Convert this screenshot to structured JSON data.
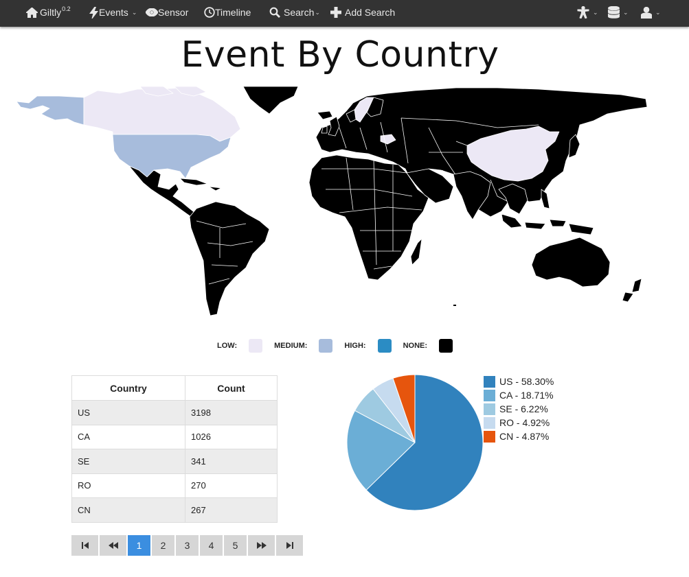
{
  "navbar": {
    "brand": "Giltly",
    "brand_version": "0.2",
    "events": "Events",
    "sensor": "Sensor",
    "timeline": "Timeline",
    "search": "Search",
    "add_search": "Add Search",
    "caret": "⌄"
  },
  "page": {
    "title": "Event By Country"
  },
  "legend": {
    "low": "LOW:",
    "medium": "MEDIUM:",
    "high": "HIGH:",
    "none": "NONE:",
    "colors": {
      "low": "#ece8f5",
      "medium": "#a7bcdc",
      "high": "#2b8cc4",
      "none": "#000000"
    }
  },
  "table": {
    "headers": [
      "Country",
      "Count"
    ],
    "rows": [
      {
        "country": "US",
        "count": "3198"
      },
      {
        "country": "CA",
        "count": "1026"
      },
      {
        "country": "SE",
        "count": "341"
      },
      {
        "country": "RO",
        "count": "270"
      },
      {
        "country": "CN",
        "count": "267"
      }
    ]
  },
  "pagination": {
    "pages": [
      "1",
      "2",
      "3",
      "4",
      "5"
    ],
    "current": "1"
  },
  "pie": {
    "legend": [
      {
        "label": "US - 58.30%",
        "color": "#3182bd"
      },
      {
        "label": "CA - 18.71%",
        "color": "#6baed6"
      },
      {
        "label": "SE - 6.22%",
        "color": "#9ecae1"
      },
      {
        "label": "RO - 4.92%",
        "color": "#c6dbef"
      },
      {
        "label": "CN - 4.87%",
        "color": "#e6550d"
      }
    ]
  }
}
